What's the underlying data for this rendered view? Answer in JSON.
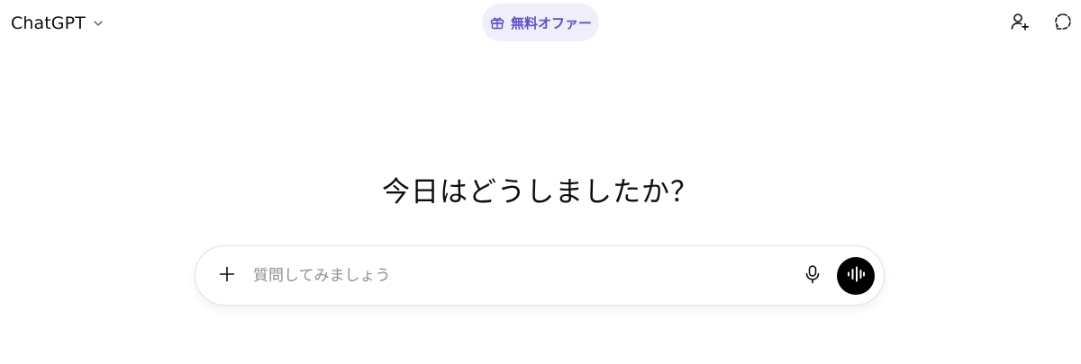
{
  "header": {
    "model_name": "ChatGPT",
    "model_icon": "chevron-down-icon",
    "offer_label": "無料オファー",
    "offer_icon": "gift-icon",
    "accent_color": "#5b4fd0",
    "offer_bg": "#efeffb",
    "right_icons": [
      "add-user-icon",
      "temporary-chat-icon"
    ]
  },
  "main": {
    "heading": "今日はどうしましたか？"
  },
  "composer": {
    "placeholder": "質問してみましょう",
    "value": "",
    "left_icon": "plus-icon",
    "mic_icon": "microphone-icon",
    "voice_icon": "voice-mode-icon",
    "voice_button_color": "#000000"
  }
}
